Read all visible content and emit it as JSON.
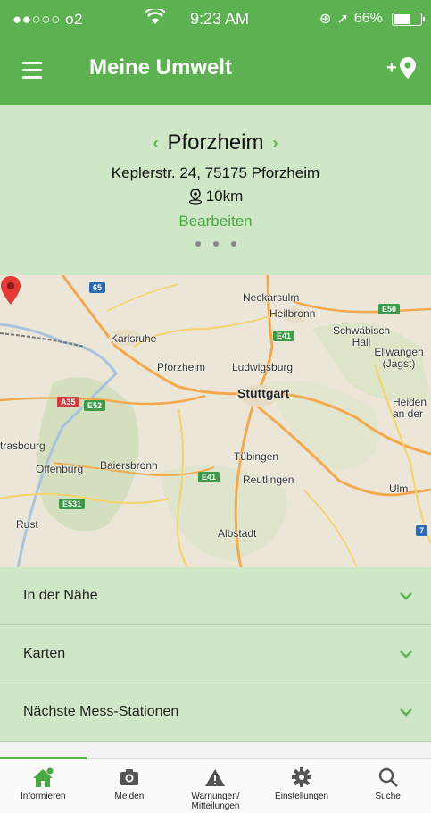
{
  "status_bar": {
    "carrier": "●●○○○ o2",
    "time": "9:23 AM",
    "battery": "66%",
    "battery_level": 0.66
  },
  "header": {
    "title": "Meine Umwelt",
    "add_place_label": "+"
  },
  "location": {
    "city": "Pforzheim",
    "address": "Keplerstr. 24, 75175 Pforzheim",
    "radius": "10km",
    "edit_label": "Bearbeiten",
    "page_dots": 3
  },
  "map": {
    "labels": {
      "neckarsulm": "Neckarsulm",
      "heilbronn": "Heilbronn",
      "schwabisch_hall": "Schwäbisch Hall",
      "ellwangen": "Ellwangen (Jagst)",
      "karlsruhe": "Karlsruhe",
      "pforzheim": "Pforzheim",
      "ludwigsburg": "Ludwigsburg",
      "stuttgart": "Stuttgart",
      "heiden": "Heiden an der",
      "strasbourg": "trasbourg",
      "offenburg": "Offenburg",
      "baiersbronn": "Baiersbronn",
      "tubingen": "Tübingen",
      "reutlingen": "Reutlingen",
      "ulm": "Ulm",
      "albstadt": "Albstadt",
      "rust": "Rust"
    },
    "shields": {
      "a65": "65",
      "e50": "E50",
      "e41a": "E41",
      "a35": "A35",
      "e52": "E52",
      "e41b": "E41",
      "e531": "E531",
      "a7": "7"
    }
  },
  "accordion": [
    {
      "label": "In der Nähe"
    },
    {
      "label": "Karten"
    },
    {
      "label": "Nächste Mess-Stationen"
    }
  ],
  "tabs": [
    {
      "label": "Informieren",
      "icon": "home-icon"
    },
    {
      "label": "Melden",
      "icon": "camera-icon"
    },
    {
      "label": "Warnungen/ Mitteilungen",
      "icon": "warning-icon"
    },
    {
      "label": "Einstellungen",
      "icon": "gear-icon"
    },
    {
      "label": "Suche",
      "icon": "search-icon"
    }
  ],
  "colors": {
    "primary": "#5cb251",
    "panel": "#cfe7c7",
    "pin": "#e53935"
  }
}
